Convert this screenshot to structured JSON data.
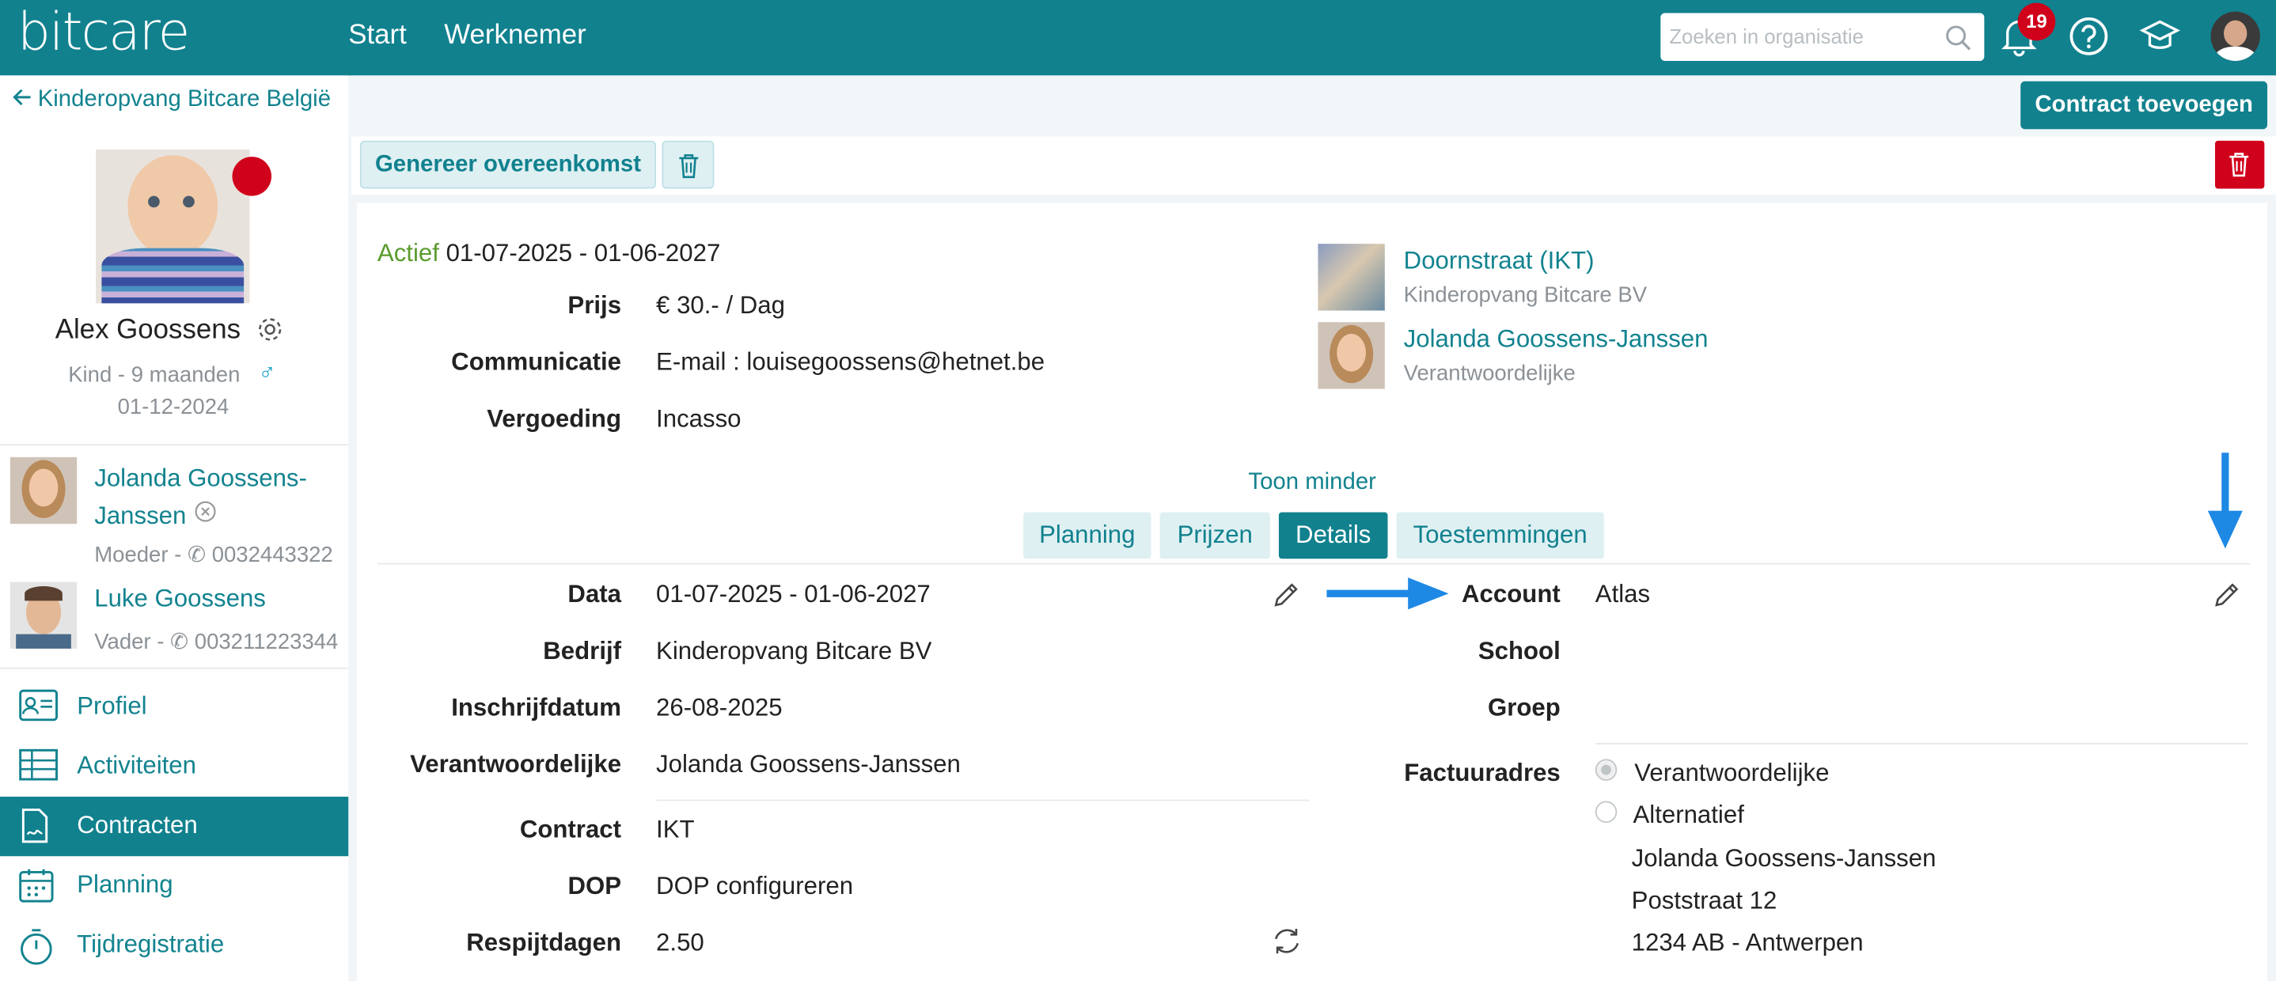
{
  "app": {
    "logo": "bitcare",
    "nav": [
      "Start",
      "Werknemer"
    ]
  },
  "search": {
    "placeholder": "Zoeken in organisatie"
  },
  "notifications": {
    "count": "19"
  },
  "toolbar": {
    "add_contract": "Contract toevoegen",
    "generate": "Genereer overeenkomst"
  },
  "breadcrumb": {
    "back_label": "Kinderopvang Bitcare België"
  },
  "child": {
    "name": "Alex Goossens",
    "type_age": "Kind - 9 maanden",
    "birthdate": "01-12-2024"
  },
  "parents": [
    {
      "name_line1": "Jolanda Goossens-",
      "name_line2": "Janssen",
      "role_phone_prefix": "Moeder - ",
      "phone": "0032443322"
    },
    {
      "name": "Luke Goossens",
      "role_phone_prefix": "Vader - ",
      "phone": "003211223344"
    }
  ],
  "menu": [
    "Profiel",
    "Activiteiten",
    "Contracten",
    "Planning",
    "Tijdregistratie"
  ],
  "contract": {
    "status": "Actief",
    "period": "01-07-2025 - 01-06-2027",
    "prijs_label": "Prijs",
    "prijs": "€ 30.- / Dag",
    "communicatie_label": "Communicatie",
    "communicatie": "E-mail : louisegoossens@hetnet.be",
    "vergoeding_label": "Vergoeding",
    "vergoeding": "Incasso",
    "location": {
      "name": "Doornstraat (IKT)",
      "org": "Kinderopvang Bitcare BV"
    },
    "responsible": {
      "name": "Jolanda Goossens-Janssen",
      "role": "Verantwoordelijke"
    },
    "toggle": "Toon minder"
  },
  "tabs": [
    "Planning",
    "Prijzen",
    "Details",
    "Toestemmingen"
  ],
  "details": {
    "data_label": "Data",
    "data": "01-07-2025 - 01-06-2027",
    "bedrijf_label": "Bedrijf",
    "bedrijf": "Kinderopvang Bitcare BV",
    "inschrijf_label": "Inschrijfdatum",
    "inschrijf": "26-08-2025",
    "verantw_label": "Verantwoordelijke",
    "verantw": "Jolanda Goossens-Janssen",
    "contract_label": "Contract",
    "contract": "IKT",
    "dop_label": "DOP",
    "dop": "DOP configureren",
    "respijt_label": "Respijtdagen",
    "respijt": "2.50",
    "account_label": "Account",
    "account": "Atlas",
    "school_label": "School",
    "groep_label": "Groep",
    "factuur_label": "Factuuradres",
    "radio1": "Verantwoordelijke",
    "radio2": "Alternatief",
    "address": [
      "Jolanda Goossens-Janssen",
      "Poststraat 12",
      "1234 AB - Antwerpen"
    ]
  },
  "colors": {
    "brand": "#11818e",
    "danger": "#d0021b",
    "arrow": "#1e88e5",
    "status_active": "#5a9b2e"
  }
}
